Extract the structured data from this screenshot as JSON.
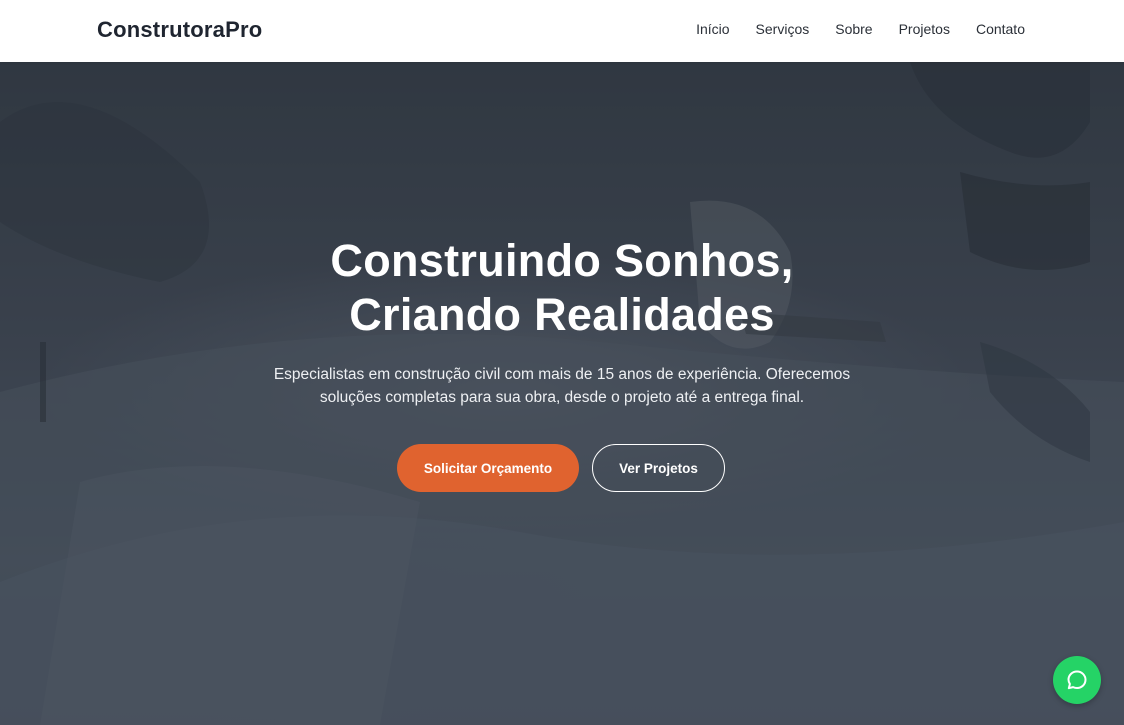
{
  "brand": {
    "name": "ConstrutoraPro"
  },
  "nav": {
    "items": [
      {
        "label": "Início"
      },
      {
        "label": "Serviços"
      },
      {
        "label": "Sobre"
      },
      {
        "label": "Projetos"
      },
      {
        "label": "Contato"
      }
    ]
  },
  "hero": {
    "title_line1": "Construindo Sonhos,",
    "title_line2": "Criando Realidades",
    "subtitle_line1": "Especialistas em construção civil com mais de 15 anos de experiência. Oferecemos",
    "subtitle_line2": "soluções completas para sua obra, desde o projeto até a entrega final.",
    "primary_button": "Solicitar Orçamento",
    "secondary_button": "Ver Projetos"
  },
  "floating": {
    "icon": "whatsapp-chat-icon"
  },
  "colors": {
    "accent": "#e0632f",
    "whatsapp": "#25d366",
    "nav_bg": "#ffffff",
    "brand_text": "#1f2530"
  }
}
